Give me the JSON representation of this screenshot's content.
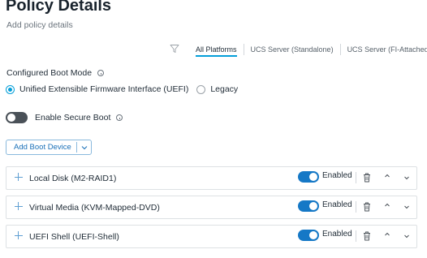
{
  "header": {
    "title": "Policy Details",
    "subtitle": "Add policy details"
  },
  "icons": {
    "filter": "filter-icon",
    "info": "info-icon",
    "plus": "plus-icon",
    "trash": "trash-icon",
    "chevron_up": "chevron-up-icon",
    "chevron_down": "chevron-down-icon"
  },
  "tabs": [
    {
      "label": "All Platforms",
      "active": true
    },
    {
      "label": "UCS Server (Standalone)",
      "active": false
    },
    {
      "label": "UCS Server (FI-Attached)",
      "active": false
    }
  ],
  "boot_mode": {
    "label": "Configured Boot Mode",
    "options": [
      {
        "label": "Unified Extensible Firmware Interface (UEFI)",
        "selected": true
      },
      {
        "label": "Legacy",
        "selected": false
      }
    ]
  },
  "secure_boot": {
    "label": "Enable Secure Boot",
    "enabled": false
  },
  "add_boot_device": {
    "label": "Add Boot Device"
  },
  "boot_devices": [
    {
      "name": "Local Disk (M2-RAID1)",
      "status": "Enabled",
      "enabled": true
    },
    {
      "name": "Virtual Media (KVM-Mapped-DVD)",
      "status": "Enabled",
      "enabled": true
    },
    {
      "name": "UEFI Shell (UEFI-Shell)",
      "status": "Enabled",
      "enabled": true
    }
  ],
  "colors": {
    "accent": "#049fd9",
    "toggle_on": "#1578c6",
    "toggle_off": "#4a5158",
    "link": "#1a70b8"
  }
}
